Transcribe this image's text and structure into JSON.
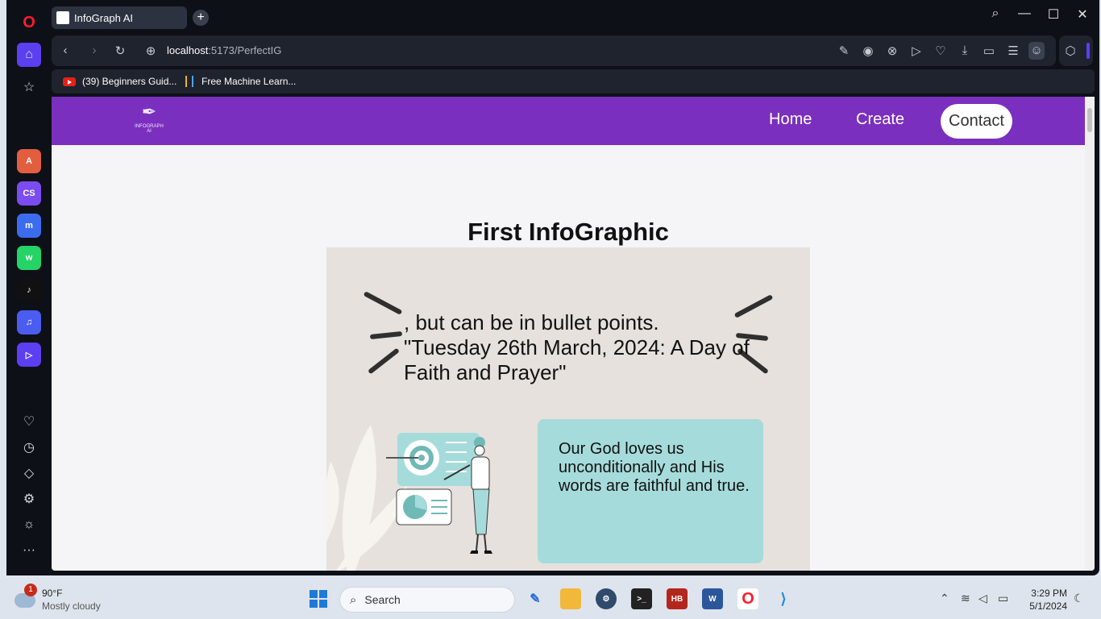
{
  "browser": {
    "tab_title": "InfoGraph AI",
    "url_host": "localhost",
    "url_path": ":5173/PerfectIG",
    "bookmarks": [
      {
        "label": "(39) Beginners Guid..."
      },
      {
        "label": "Free Machine Learn..."
      }
    ]
  },
  "site": {
    "logo_text": "INFOGRAPH",
    "logo_sub": "AI",
    "nav": {
      "home": "Home",
      "create": "Create",
      "contact": "Contact"
    }
  },
  "page": {
    "title": "First InfoGraphic",
    "headline": ", but can be in bullet points. \"Tuesday 26th March, 2024: A Day of Faith and Prayer\"",
    "box_text": "Our God loves us unconditionally and His words are faithful and true."
  },
  "taskbar": {
    "weather_temp": "90°F",
    "weather_desc": "Mostly cloudy",
    "weather_badge": "1",
    "search_placeholder": "Search",
    "time": "3:29 PM",
    "date": "5/1/2024"
  },
  "colors": {
    "nav_purple": "#7b2fbe",
    "infographic_bg": "#e6e1dc",
    "teal_box": "#a6dbdb"
  }
}
